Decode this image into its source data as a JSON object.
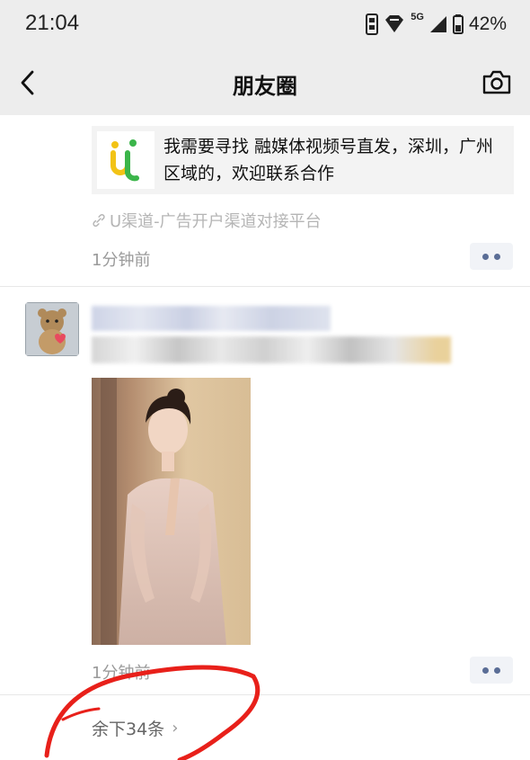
{
  "status_bar": {
    "time": "21:04",
    "network": "5G",
    "battery": "42%"
  },
  "nav": {
    "title": "朋友圈",
    "back_icon": "chevron-left-icon",
    "camera_icon": "camera-icon"
  },
  "ad": {
    "text": "我需要寻找 融媒体视频号直发，深圳，广州区域的，欢迎联系合作",
    "source": "U渠道-广告开户渠道对接平台",
    "time": "1分钟前",
    "logo_color_green": "#3bb54a",
    "logo_color_yellow": "#f2c316"
  },
  "post": {
    "time": "1分钟前",
    "remaining": "余下34条"
  },
  "colors": {
    "header_bg": "#ededed",
    "link_blue": "#5a6d96",
    "annotation_red": "#e8201a"
  }
}
